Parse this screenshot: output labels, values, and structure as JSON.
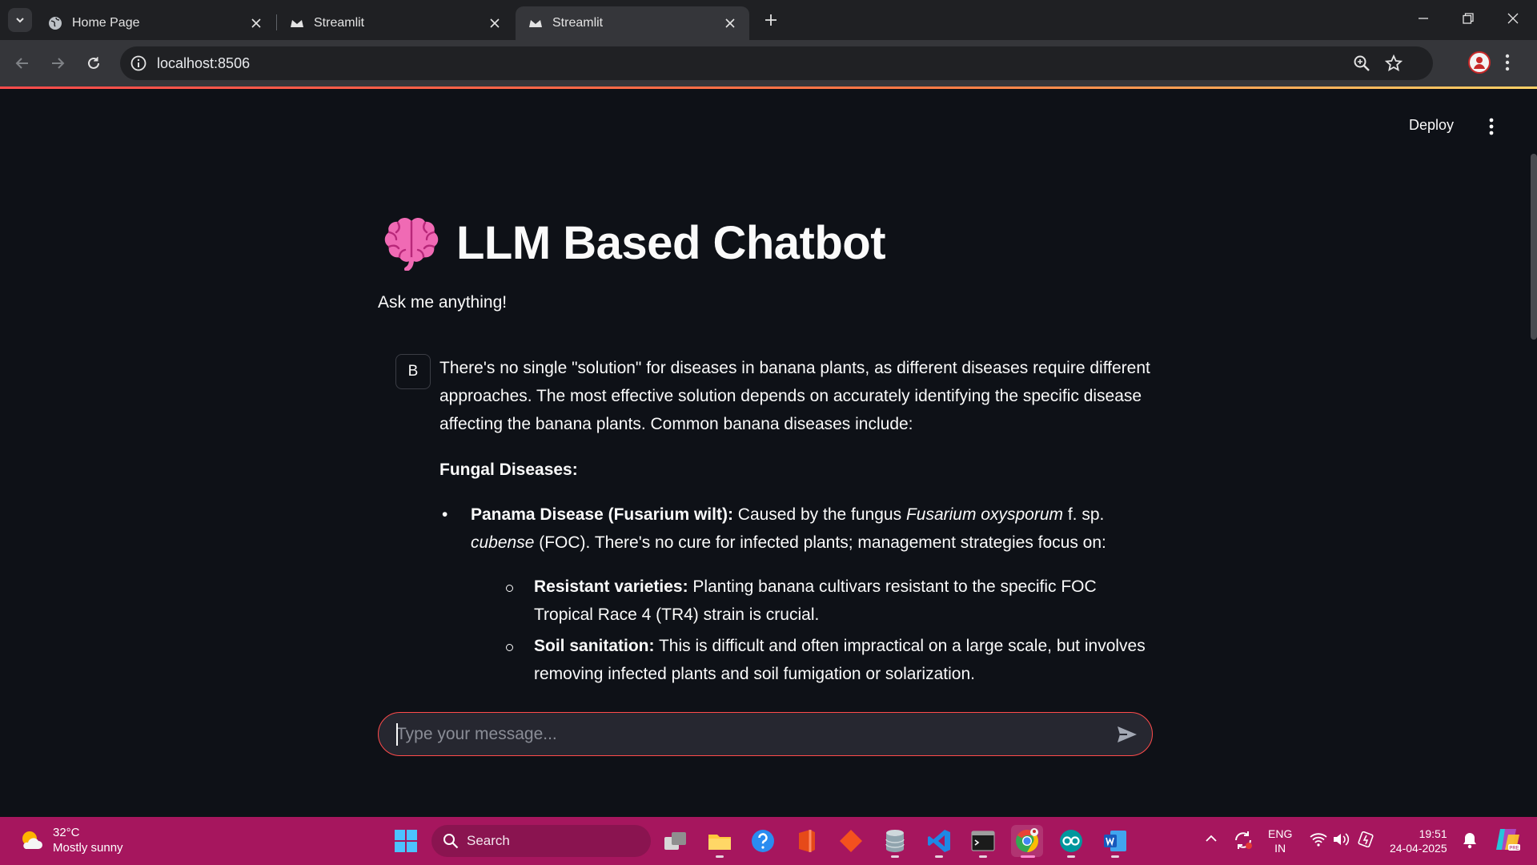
{
  "browser": {
    "tabs": [
      {
        "title": "Home Page",
        "active": false
      },
      {
        "title": "Streamlit",
        "active": false
      },
      {
        "title": "Streamlit",
        "active": true
      }
    ],
    "url": "localhost:8506"
  },
  "app": {
    "deploy_label": "Deploy",
    "title": "LLM Based Chatbot",
    "subtitle": "Ask me anything!",
    "message": {
      "avatar_letter": "B",
      "intro": "There's no single \"solution\" for diseases in banana plants, as different diseases require different approaches. The most effective solution depends on accurately identifying the specific disease affecting the banana plants. Common banana diseases include:",
      "heading": "Fungal Diseases:",
      "item1": {
        "bold": "Panama Disease (Fusarium wilt):",
        "text_a": " Caused by the fungus ",
        "italic_a": "Fusarium oxysporum",
        "text_b": " f. sp. ",
        "italic_b": "cubense",
        "text_c": " (FOC). There's no cure for infected plants; management strategies focus on:"
      },
      "subitems": [
        {
          "bold": "Resistant varieties:",
          "text": " Planting banana cultivars resistant to the specific FOC Tropical Race 4 (TR4) strain is crucial."
        },
        {
          "bold": "Soil sanitation:",
          "text": " This is difficult and often impractical on a large scale, but involves removing infected plants and soil fumigation or solarization."
        }
      ]
    },
    "input_placeholder": "Type your message...",
    "accent_color": "#ff4b4b"
  },
  "taskbar": {
    "weather_temp": "32°C",
    "weather_desc": "Mostly sunny",
    "search_label": "Search",
    "lang_line1": "ENG",
    "lang_line2": "IN",
    "time": "19:51",
    "date": "24-04-2025",
    "color": "#a6165e"
  }
}
